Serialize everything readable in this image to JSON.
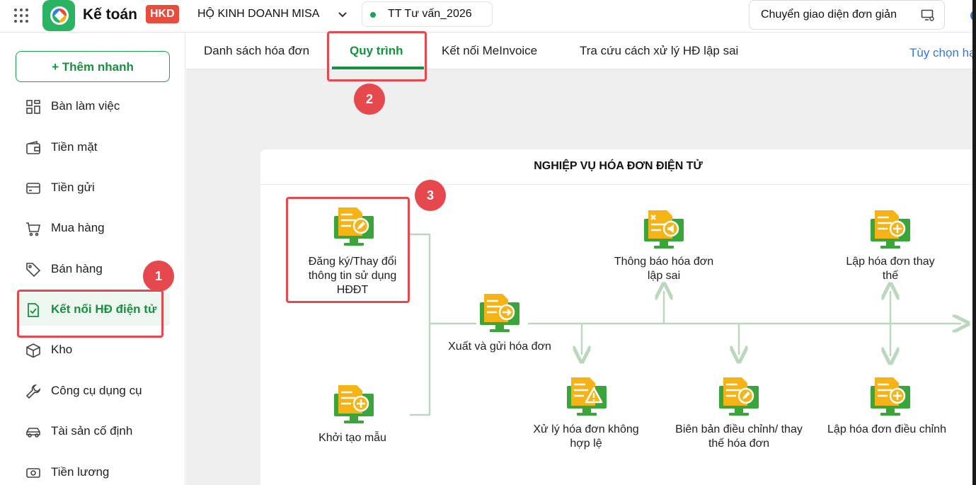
{
  "header": {
    "app_name": "Kế toán",
    "badge": "HKD",
    "company": "HỘ KINH DOANH MISA",
    "unit": "TT Tư vấn_2026",
    "simple_mode_label": "Chuyển giao diện đơn giản"
  },
  "sidebar": {
    "quick_add": "+ Thêm nhanh",
    "items": [
      {
        "label": "Bàn làm việc",
        "icon": "dashboard-icon"
      },
      {
        "label": "Tiền mặt",
        "icon": "wallet-icon"
      },
      {
        "label": "Tiền gửi",
        "icon": "card-icon"
      },
      {
        "label": "Mua hàng",
        "icon": "cart-icon"
      },
      {
        "label": "Bán hàng",
        "icon": "tag-icon"
      },
      {
        "label": "Kết nối HĐ điện tử",
        "icon": "invoice-check-icon",
        "active": true
      },
      {
        "label": "Kho",
        "icon": "box-icon"
      },
      {
        "label": "Công cụ dụng cụ",
        "icon": "wrench-icon"
      },
      {
        "label": "Tài sản cố định",
        "icon": "car-icon"
      },
      {
        "label": "Tiền lương",
        "icon": "money-icon"
      }
    ]
  },
  "tabs": {
    "items": [
      "Danh sách hóa đơn",
      "Quy trình",
      "Kết nối MeInvoice",
      "Tra cứu cách xử lý HĐ lập sai"
    ],
    "active": "Quy trình",
    "customize": "Tùy chọn hạ"
  },
  "card": {
    "title": "NGHIỆP VỤ HÓA ĐƠN ĐIỆN TỬ",
    "nodes": {
      "register": "Đăng ký/Thay đổi thông tin sử dụng HĐĐT",
      "init_template": "Khởi tạo mẫu",
      "issue": "Xuất và gửi hóa đơn",
      "notify_wrong": "Thông báo hóa đơn lập sai",
      "replace": "Lập hóa đơn thay thế",
      "invalid": "Xử lý hóa đơn không hợp lệ",
      "minutes": "Biên bản điều chỉnh/ thay thế hóa đơn",
      "adjust": "Lập hóa đơn điều chỉnh"
    }
  },
  "annotations": {
    "step1": "1",
    "step2": "2",
    "step3": "3"
  },
  "colors": {
    "accent": "#14923f",
    "annotation": "#e5484d",
    "link": "#2a7ae2",
    "icon_doc": "#f5b316",
    "icon_monitor": "#3aa53a",
    "flow_line": "#b9d8bd"
  }
}
